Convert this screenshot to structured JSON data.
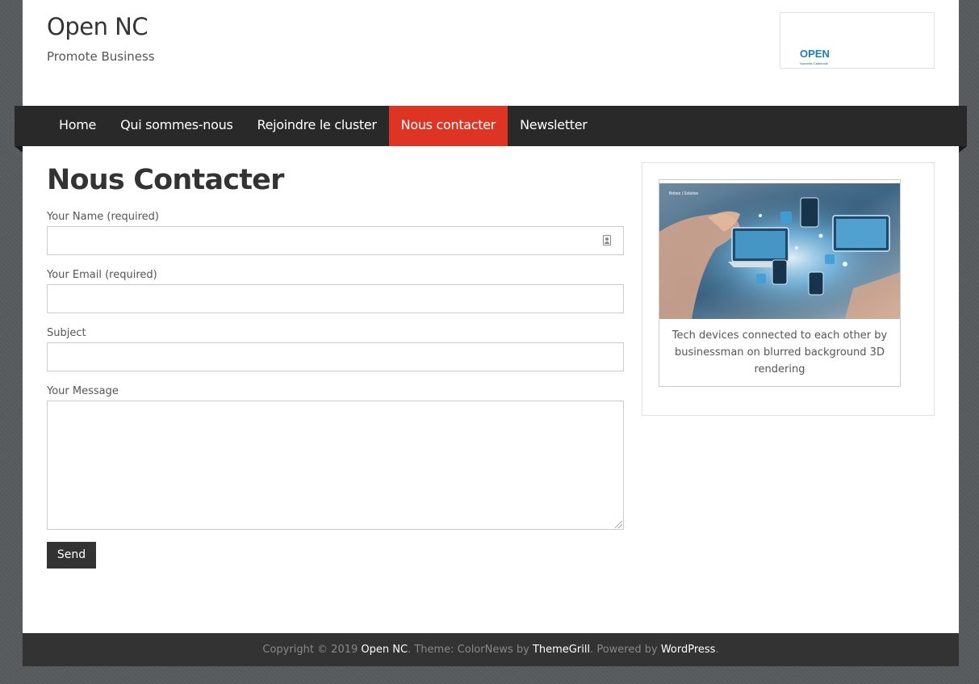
{
  "site": {
    "title": "Open NC",
    "tagline": "Promote Business",
    "logo_text": "OPEN",
    "logo_subtext": "Nouvelle-Calédonie"
  },
  "nav": {
    "items": [
      {
        "label": "Home"
      },
      {
        "label": "Qui sommes-nous"
      },
      {
        "label": "Rejoindre le cluster"
      },
      {
        "label": "Nous contacter",
        "active": true
      },
      {
        "label": "Newsletter"
      }
    ],
    "active_color": "#dd3424"
  },
  "main": {
    "heading": "Nous Contacter",
    "form": {
      "name_label": "Your Name (required)",
      "name_value": "",
      "email_label": "Your Email (required)",
      "email_value": "",
      "subject_label": "Subject",
      "subject_value": "",
      "message_label": "Your Message",
      "message_value": "",
      "send_label": "Send"
    }
  },
  "sidebar": {
    "image_caption": "Tech devices connected to each other by businessman on blurred background 3D rendering",
    "image_overlay_text": "Bebes | Solution"
  },
  "footer": {
    "prefix": "Copyright © 2019 ",
    "site_link": "Open NC",
    "theme_text": ". Theme: ColorNews by ",
    "theme_link": "ThemeGrill",
    "powered_text": ". Powered by ",
    "wp_link": "WordPress",
    "suffix": "."
  },
  "colors": {
    "background": "#56595c",
    "nav_background": "#292929",
    "footer_background": "#333333",
    "button_background": "#333333"
  }
}
